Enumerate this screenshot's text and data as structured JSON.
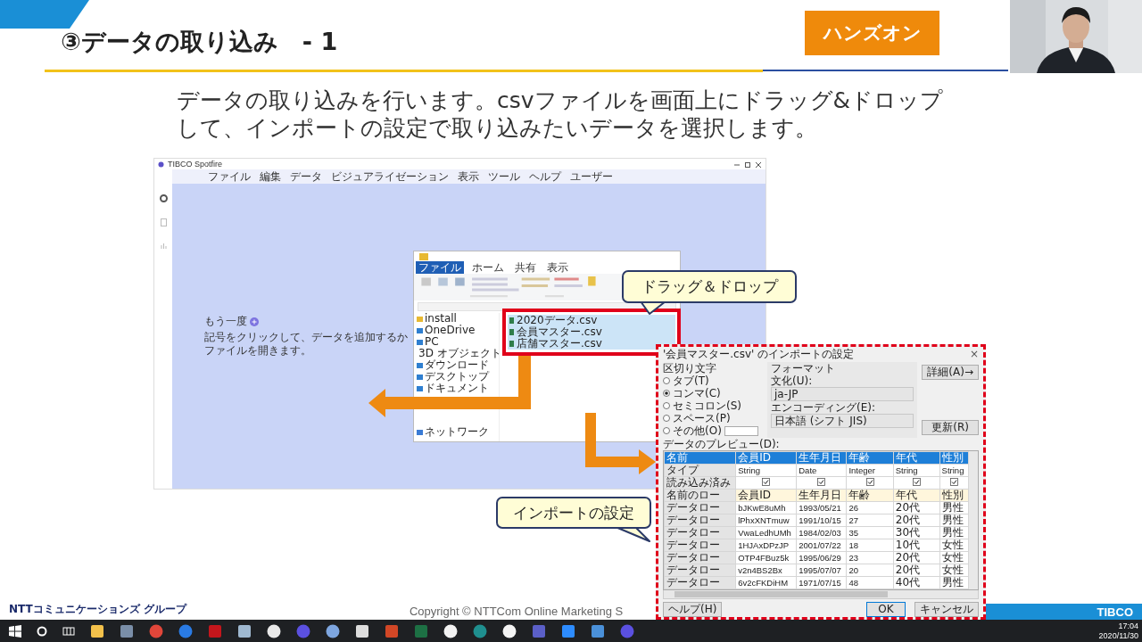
{
  "slide": {
    "title": "③データの取り込み　- 1",
    "badge": "ハンズオン",
    "body": [
      "データの取り込みを行います。csvファイルを画面上にドラッグ&ドロップ",
      "して、インポートの設定で取り込みたいデータを選択します。"
    ]
  },
  "spotfire": {
    "title": "TIBCO Spotfire",
    "menu": [
      "ファイル",
      "編集",
      "データ",
      "ビジュアライゼーション",
      "表示",
      "ツール",
      "ヘルプ",
      "ユーザー"
    ],
    "hint_before": "もう一度",
    "hint_after": "記号をクリックして、データを追加するかファイルを開きます。"
  },
  "explorer": {
    "tabs": [
      {
        "label": "ファイル",
        "selected": true
      },
      {
        "label": "ホーム",
        "selected": false
      },
      {
        "label": "共有",
        "selected": false
      },
      {
        "label": "表示",
        "selected": false
      }
    ],
    "nav": [
      "install",
      "OneDrive",
      "PC",
      "3D オブジェクト",
      "ダウンロード",
      "デスクトップ",
      "ドキュメント"
    ],
    "network": "ネットワーク",
    "files": [
      {
        "name": "2020データ.csv",
        "selected": true
      },
      {
        "name": "会員マスター.csv",
        "selected": true
      },
      {
        "name": "店舗マスター.csv",
        "selected": true
      }
    ]
  },
  "callouts": {
    "drag": "ドラッグ＆ドロップ",
    "import": "インポートの設定"
  },
  "dialog": {
    "title": "'会員マスター.csv' のインポートの設定",
    "close": "×",
    "delimiter_label": "区切り文字",
    "delimiters": [
      {
        "label": "タブ(T)",
        "selected": false
      },
      {
        "label": "コンマ(C)",
        "selected": true
      },
      {
        "label": "セミコロン(S)",
        "selected": false
      },
      {
        "label": "スペース(P)",
        "selected": false
      },
      {
        "label": "その他(O)",
        "selected": false
      }
    ],
    "format_label": "フォーマット",
    "culture_label": "文化(U):",
    "culture": "ja-JP",
    "encoding_label": "エンコーディング(E):",
    "encoding": "日本語 (シフト JIS)",
    "details_button": "詳細(A)→",
    "refresh_button": "更新(R)",
    "preview_label": "データのプレビュー(D):",
    "columns": [
      "名前",
      "会員ID",
      "生年月日",
      "年齢",
      "年代",
      "性別"
    ],
    "type_label": "タイプ",
    "types": [
      "String",
      "Date",
      "Integer",
      "String",
      "String"
    ],
    "load_label": "読み込み済み",
    "loaded": [
      {
        "checked": true
      },
      {
        "checked": true
      },
      {
        "checked": true
      },
      {
        "checked": true
      },
      {
        "checked": true
      }
    ],
    "name_row_label": "名前のロー",
    "name_row": [
      "会員ID",
      "生年月日",
      "年齢",
      "年代",
      "性別"
    ],
    "rows": [
      {
        "cells": [
          "データロー",
          "bJKwE8uMh",
          "1993/05/21",
          "26",
          "20代",
          "男性"
        ]
      },
      {
        "cells": [
          "データロー",
          "lPhxXNTmuw",
          "1991/10/15",
          "27",
          "20代",
          "男性"
        ]
      },
      {
        "cells": [
          "データロー",
          "VwaLedhUMh",
          "1984/02/03",
          "35",
          "30代",
          "男性"
        ]
      },
      {
        "cells": [
          "データロー",
          "1HJAxDPzJP",
          "2001/07/22",
          "18",
          "10代",
          "女性"
        ]
      },
      {
        "cells": [
          "データロー",
          "OTP4FBuz5k",
          "1995/06/29",
          "23",
          "20代",
          "女性"
        ]
      },
      {
        "cells": [
          "データロー",
          "v2n4BS2Bx",
          "1995/07/07",
          "20",
          "20代",
          "女性"
        ]
      },
      {
        "cells": [
          "データロー",
          "6v2cFKDiHM",
          "1971/07/15",
          "48",
          "40代",
          "男性"
        ]
      }
    ],
    "help_button": "ヘルプ(H)",
    "ok_button": "OK",
    "cancel_button": "キャンセル"
  },
  "footer": {
    "group": "NTTコミュニケーションズ グループ",
    "copyright": "Copyright © NTTCom Online Marketing S",
    "logo": "TIBCO"
  },
  "taskbar": {
    "time": "17:04",
    "date": "2020/11/30"
  }
}
